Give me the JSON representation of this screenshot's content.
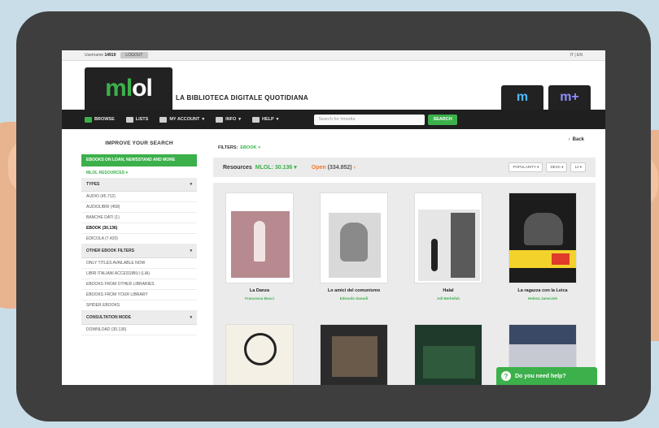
{
  "topbar": {
    "username_label": "Username",
    "username_value": "14919",
    "logout": "LOGOUT",
    "lang": "IT | EN"
  },
  "header": {
    "logo_m": "ml",
    "logo_rest": "ol",
    "tagline": "LA BIBLIOTECA DIGITALE QUOTIDIANA",
    "app_tabs": [
      "m",
      "m+"
    ]
  },
  "navbar": {
    "items": [
      "BROWSE",
      "LISTS",
      "MY ACCOUNT",
      "INFO",
      "HELP"
    ],
    "search_placeholder": "Search for #media",
    "search_button": "SEARCH"
  },
  "sidebar": {
    "improve": "IMPROVE YOUR SEARCH",
    "green_block": "EBOOKS ON LOAN, NEWSSTAND AND MORE",
    "resources_toggle": "MLOL RESOURCES",
    "types_head": "TYPES",
    "types": [
      "AUDIO (45.712)",
      "AUDIOLIBRI (458)",
      "BANCHE DATI (1)",
      "EBOOK (30.136)",
      "EDICOLA (7.420)"
    ],
    "ebook_filters_head": "OTHER EBOOK FILTERS",
    "ebook_filters": [
      "ONLY TITLES AVAILABLE NOW",
      "LIBRI ITALIANI ACCESSIBILI (LIA)",
      "EBOOKS FROM OTHER LIBRARIES",
      "EBOOKS FROM YOUR LIBRARY",
      "SPIDER EBOOKS"
    ],
    "consultation_head": "CONSULTATION MODE",
    "consultation": [
      "DOWNLOAD (30.136)"
    ]
  },
  "main": {
    "filters_label": "FILTERS:",
    "filters_tag": "EBOOK",
    "back": "Back",
    "resources_label": "Resources",
    "resources_count": "MLOL: 30.136",
    "open_label": "Open",
    "open_count": "(334.852)",
    "sort_options": [
      "POPULARITY",
      "DESC",
      "12"
    ],
    "books": [
      {
        "title": "La Danza",
        "author": "Francesca Bucci"
      },
      {
        "title": "Lo amici del comunismo",
        "author": "Edoardo Sanudi"
      },
      {
        "title": "Halal",
        "author": "Adi Berhefah"
      },
      {
        "title": "La ragazza con la Leica",
        "author": "Helena Janeczek"
      }
    ]
  },
  "help": {
    "label": "Do you need help?",
    "icon": "?"
  }
}
